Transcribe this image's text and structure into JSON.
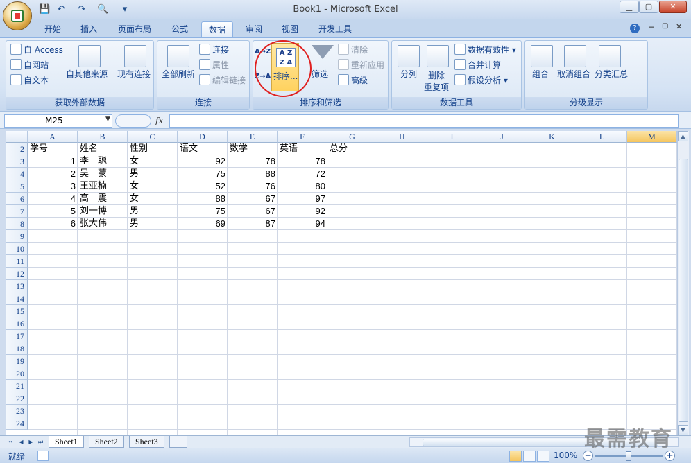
{
  "window": {
    "title": "Book1 - Microsoft Excel",
    "minimize": "▁",
    "restore": "▢",
    "close": "✕"
  },
  "qat": {
    "save": "💾",
    "undo": "↶",
    "redo": "↷",
    "preview": "🔍",
    "customize": "▾"
  },
  "tabs": [
    "开始",
    "插入",
    "页面布局",
    "公式",
    "数据",
    "审阅",
    "视图",
    "开发工具"
  ],
  "active_tab": "数据",
  "ribbon_right": {
    "help": "?",
    "minimize": "−",
    "restore": "▢",
    "close": "✕"
  },
  "groups": {
    "external": {
      "label": "获取外部数据",
      "access": "自 Access",
      "web": "自网站",
      "text": "自文本",
      "other": "自其他来源",
      "existing": "现有连接"
    },
    "connections": {
      "label": "连接",
      "refresh_all": "全部刷新",
      "connections": "连接",
      "properties": "属性",
      "edit_links": "编辑链接"
    },
    "sort_filter": {
      "label": "排序和筛选",
      "sort_az": "A→Z",
      "sort_za": "Z→A",
      "sort": "排序...",
      "filter": "筛选",
      "clear": "清除",
      "reapply": "重新应用",
      "advanced": "高级"
    },
    "data_tools": {
      "label": "数据工具",
      "text_to_columns": "分列",
      "remove_dup_line1": "删除",
      "remove_dup_line2": "重复项",
      "validation": "数据有效性",
      "consolidate": "合并计算",
      "whatif": "假设分析"
    },
    "outline": {
      "label": "分级显示",
      "group": "组合",
      "ungroup": "取消组合",
      "subtotal": "分类汇总"
    }
  },
  "formula_bar": {
    "name_box": "M25",
    "fx": "fx",
    "formula": ""
  },
  "columns": [
    "A",
    "B",
    "C",
    "D",
    "E",
    "F",
    "G",
    "H",
    "I",
    "J",
    "K",
    "L",
    "M"
  ],
  "selected_column": "M",
  "rows": [
    2,
    3,
    4,
    5,
    6,
    7,
    8,
    9,
    10,
    11,
    12,
    13,
    14,
    15,
    16,
    17,
    18,
    19,
    20,
    21,
    22,
    23,
    24
  ],
  "header_row": {
    "A": "学号",
    "B": "姓名",
    "C": "性别",
    "D": "语文",
    "E": "数学",
    "F": "英语",
    "G": "总分"
  },
  "data_rows": [
    {
      "A": "1",
      "B": "李　聪",
      "C": "女",
      "D": "92",
      "E": "78",
      "F": "78"
    },
    {
      "A": "2",
      "B": "吴　蒙",
      "C": "男",
      "D": "75",
      "E": "88",
      "F": "72"
    },
    {
      "A": "3",
      "B": "王亚楠",
      "C": "女",
      "D": "52",
      "E": "76",
      "F": "80"
    },
    {
      "A": "4",
      "B": "高　震",
      "C": "女",
      "D": "88",
      "E": "67",
      "F": "97"
    },
    {
      "A": "5",
      "B": "刘一博",
      "C": "男",
      "D": "75",
      "E": "67",
      "F": "92"
    },
    {
      "A": "6",
      "B": "张大伟",
      "C": "男",
      "D": "69",
      "E": "87",
      "F": "94"
    }
  ],
  "sheets": [
    "Sheet1",
    "Sheet2",
    "Sheet3"
  ],
  "active_sheet": "Sheet1",
  "status": {
    "ready": "就绪",
    "zoom": "100%",
    "zoom_out": "−",
    "zoom_in": "+"
  },
  "watermark": "最需教育",
  "colors": {
    "accent": "#15428b",
    "highlight": "#ffd25e",
    "circle": "#e02020"
  }
}
